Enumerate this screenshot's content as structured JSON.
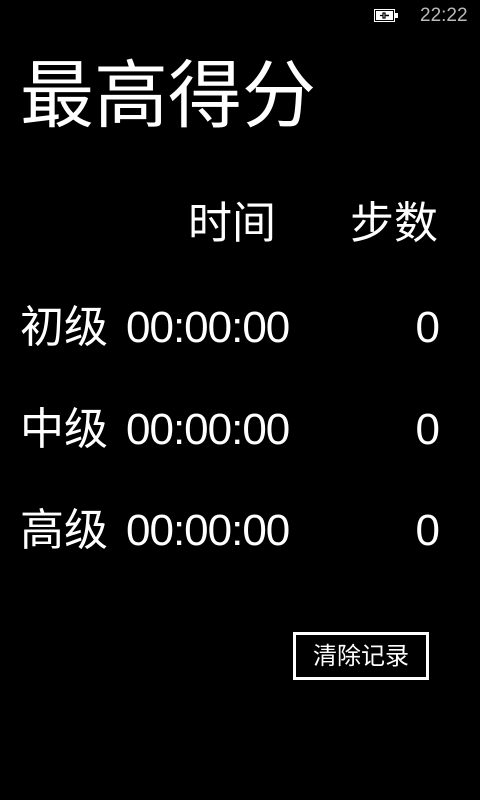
{
  "status_bar": {
    "time": "22:22",
    "battery_icon": "battery-charging-icon"
  },
  "page": {
    "title": "最高得分"
  },
  "table": {
    "headers": {
      "time": "时间",
      "steps": "步数"
    },
    "rows": [
      {
        "level": "初级",
        "time": "00:00:00",
        "steps": "0"
      },
      {
        "level": "中级",
        "time": "00:00:00",
        "steps": "0"
      },
      {
        "level": "高级",
        "time": "00:00:00",
        "steps": "0"
      }
    ]
  },
  "actions": {
    "clear_label": "清除记录"
  },
  "colors": {
    "background": "#000000",
    "foreground": "#ffffff",
    "status_text": "#bbbbbb"
  }
}
